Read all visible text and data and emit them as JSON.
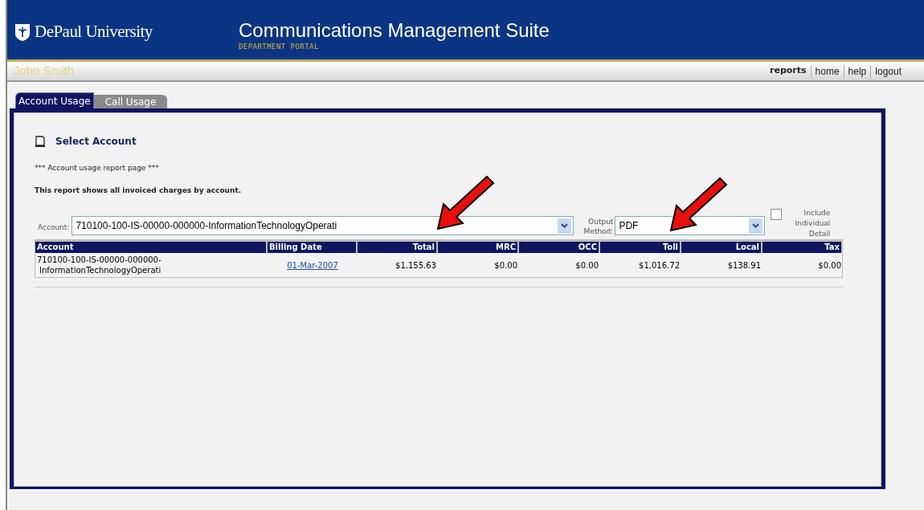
{
  "header": {
    "logo": "DePaul University",
    "title": "Communications Management Suite",
    "subtitle": "DEPARTMENT PORTAL"
  },
  "user": "John Smith",
  "nav": [
    {
      "label": "reports",
      "selected": true
    },
    {
      "label": "home",
      "selected": false
    },
    {
      "label": "help",
      "selected": false
    },
    {
      "label": "logout",
      "selected": false
    }
  ],
  "tabs": [
    {
      "label": "Account Usage",
      "selected": true
    },
    {
      "label": "Call Usage",
      "selected": false
    }
  ],
  "section_title": "Select Account",
  "note": "*** Account usage report page ***",
  "description": "This report shows all invoiced charges by account.",
  "account_field": {
    "label": "Account:",
    "value": "710100-100-IS-00000-000000-InformationTechnologyOperati"
  },
  "output_field": {
    "label": "Output Method:",
    "value": "PDF"
  },
  "include_detail": {
    "label": "Include Individual Detail",
    "checked": false
  },
  "table": {
    "columns": [
      "Account",
      "Billing Date",
      "Total",
      "MRC",
      "OCC",
      "Toll",
      "Local",
      "Tax"
    ],
    "rows": [
      [
        "710100-100-IS-00000-000000-InformationTechnologyOperati",
        "01-Mar-2007",
        "$1,155.63",
        "$0.00",
        "$0.00",
        "$1,016.72",
        "$138.91",
        "$0.00"
      ]
    ]
  }
}
